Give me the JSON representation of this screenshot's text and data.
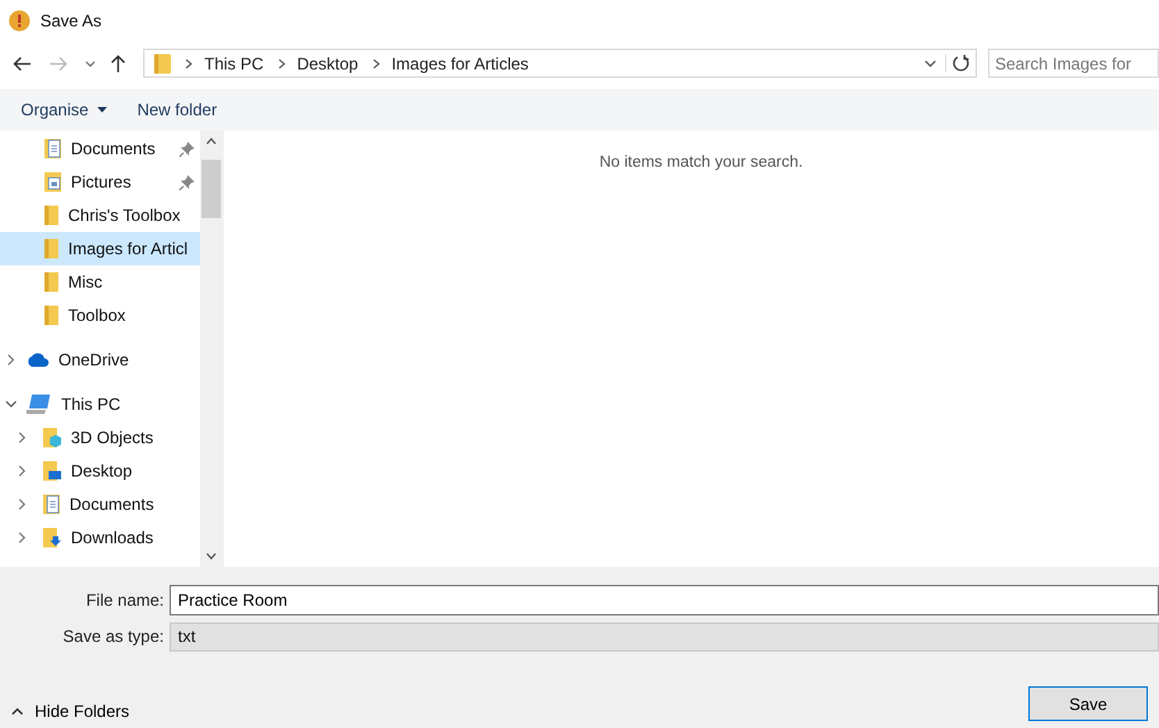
{
  "window": {
    "title": "Save As"
  },
  "address": {
    "crumbs": [
      "This PC",
      "Desktop",
      "Images for Articles"
    ],
    "search_placeholder": "Search Images for"
  },
  "toolbar": {
    "organise": "Organise",
    "new_folder": "New folder"
  },
  "quick_items": [
    {
      "label": "Documents",
      "kind": "documents",
      "pinned": true,
      "selected": false
    },
    {
      "label": "Pictures",
      "kind": "pictures",
      "pinned": true,
      "selected": false
    },
    {
      "label": "Chris's Toolbox",
      "kind": "folder",
      "pinned": false,
      "selected": false
    },
    {
      "label": "Images for Articl",
      "kind": "folder",
      "pinned": false,
      "selected": true
    },
    {
      "label": "Misc",
      "kind": "folder",
      "pinned": false,
      "selected": false
    },
    {
      "label": "Toolbox",
      "kind": "folder",
      "pinned": false,
      "selected": false
    }
  ],
  "tree": [
    {
      "label": "OneDrive",
      "kind": "cloud",
      "expanded": false
    },
    {
      "label": "This PC",
      "kind": "pc",
      "expanded": true,
      "children": [
        {
          "label": "3D Objects",
          "kind": "objects",
          "expanded": false
        },
        {
          "label": "Desktop",
          "kind": "desktop",
          "expanded": false
        },
        {
          "label": "Documents",
          "kind": "documents",
          "expanded": false
        },
        {
          "label": "Downloads",
          "kind": "downloads",
          "expanded": false
        }
      ]
    }
  ],
  "content": {
    "empty_message": "No items match your search."
  },
  "form": {
    "file_name_label": "File name:",
    "file_name": "Practice Room",
    "type_label": "Save as type:",
    "type": "txt"
  },
  "footer": {
    "hide_folders": "Hide Folders",
    "save": "Save"
  }
}
